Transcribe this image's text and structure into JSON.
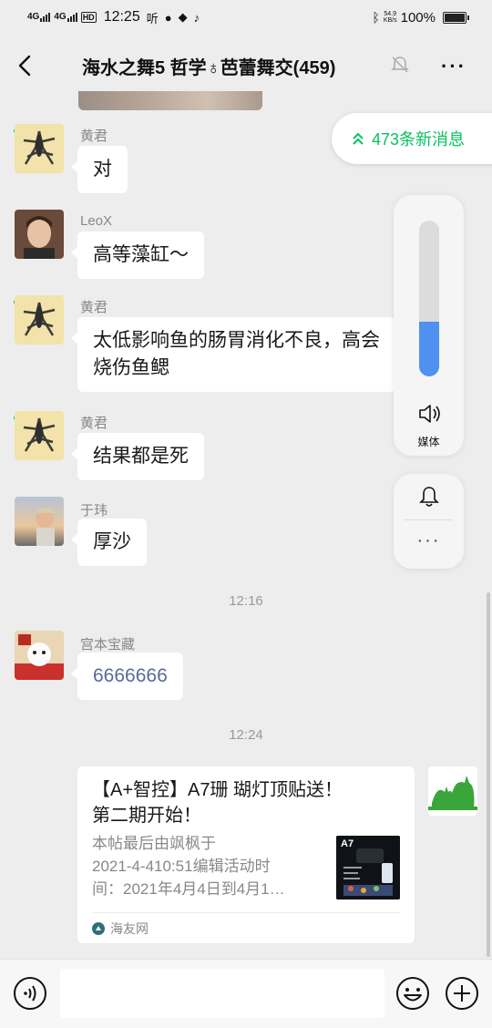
{
  "status_bar": {
    "network1": "4G",
    "network2": "4G",
    "hd": "HD",
    "time": "12:25",
    "extra_icons": "听",
    "net_speed": "54.9",
    "net_speed_unit": "KB/s",
    "battery": "100%"
  },
  "header": {
    "title": "海水之舞5 哲学♁芭蕾舞交(459)"
  },
  "new_messages": {
    "label": "473条新消息"
  },
  "volume_panel": {
    "label": "媒体",
    "level": 0.35
  },
  "messages": [
    {
      "sender": "黄君",
      "text": "对"
    },
    {
      "sender": "LeoX",
      "text": "高等藻缸～"
    },
    {
      "sender": "黄君",
      "text_line1": "太低影响鱼的肠胃消化不良，高会",
      "text_line2": "烧伤鱼鳃"
    },
    {
      "sender": "黄君",
      "text": "结果都是死"
    },
    {
      "sender": "于玮",
      "text": "厚沙"
    },
    {
      "sender": "宫本宝藏",
      "text": "6666666"
    }
  ],
  "timestamps": [
    "12:16",
    "12:24"
  ],
  "link_card": {
    "title_line1": "【A+智控】A7珊 瑚灯顶贴送！",
    "title_line2": "第二期开始！",
    "desc_line1": "本帖最后由飒枫于",
    "desc_line2": "2021-4-410:51编辑活动时",
    "desc_line3": "间：2021年4月4日到4月1…",
    "thumb_label": "A7",
    "source": "海友网"
  },
  "input": {
    "placeholder": ""
  },
  "colors": {
    "accent_green": "#07c160",
    "volume_blue": "#4e91f0",
    "link_blue": "#576b95"
  }
}
